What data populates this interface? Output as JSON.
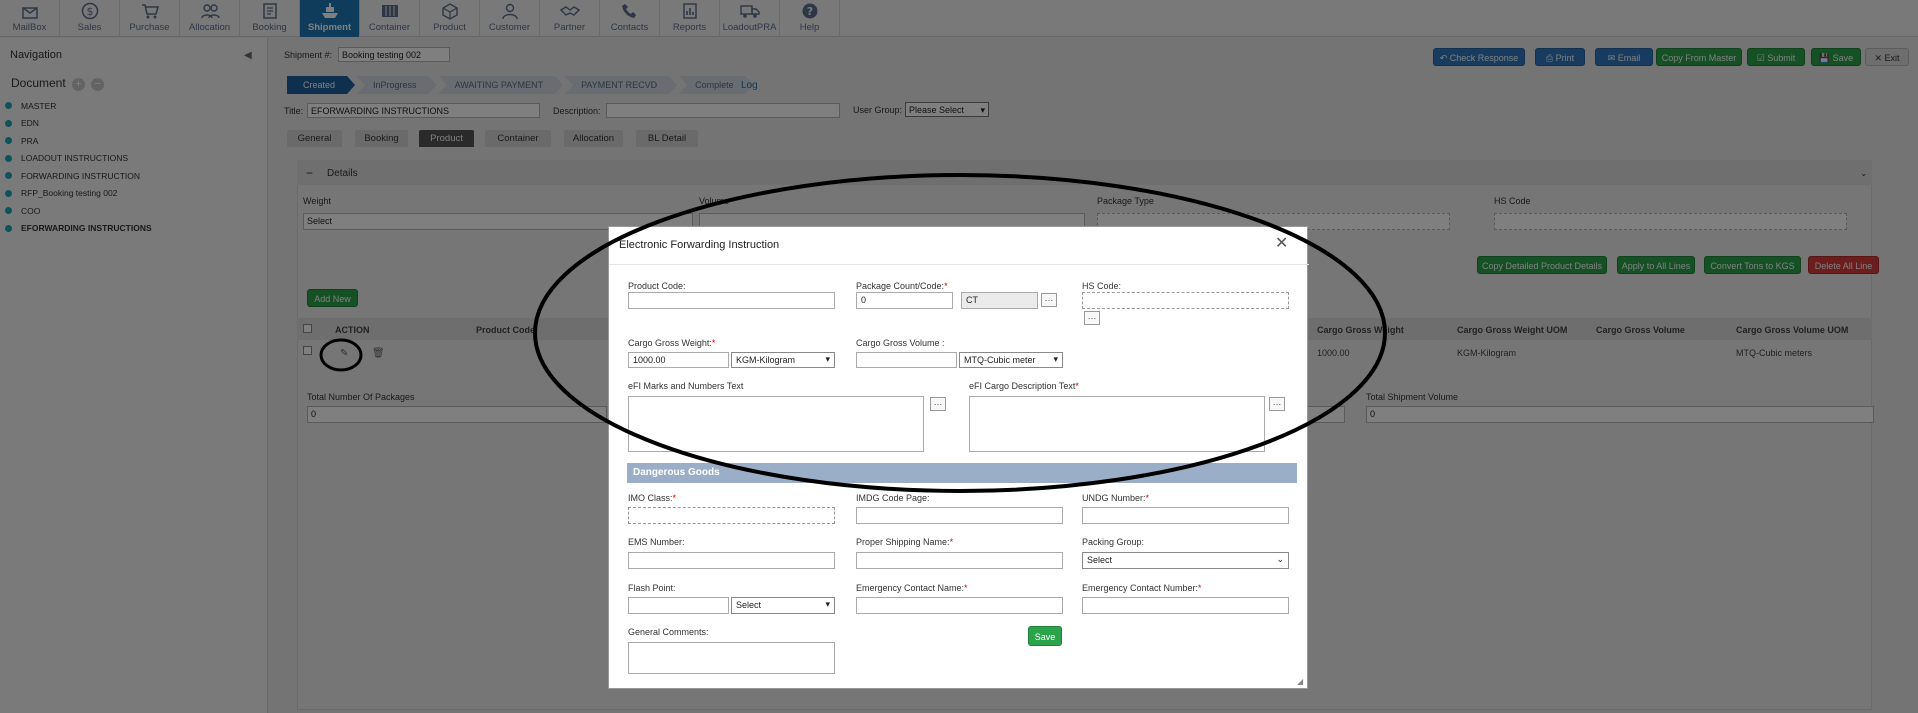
{
  "topnav": [
    {
      "label": "MailBox",
      "icon": "mailbox-icon"
    },
    {
      "label": "Sales",
      "icon": "dollar-icon"
    },
    {
      "label": "Purchase",
      "icon": "cart-icon"
    },
    {
      "label": "Allocation",
      "icon": "people-icon"
    },
    {
      "label": "Booking",
      "icon": "booking-icon"
    },
    {
      "label": "Shipment",
      "icon": "ship-icon",
      "active": true
    },
    {
      "label": "Container",
      "icon": "container-icon"
    },
    {
      "label": "Product",
      "icon": "product-icon"
    },
    {
      "label": "Customer",
      "icon": "customer-icon"
    },
    {
      "label": "Partner",
      "icon": "handshake-icon"
    },
    {
      "label": "Contacts",
      "icon": "phone-icon"
    },
    {
      "label": "Reports",
      "icon": "report-icon"
    },
    {
      "label": "LoadoutPRA",
      "icon": "truck-icon"
    },
    {
      "label": "Help",
      "icon": "help-icon"
    }
  ],
  "sidebar": {
    "title": "Navigation",
    "document_label": "Document",
    "items": [
      {
        "label": "MASTER"
      },
      {
        "label": "EDN"
      },
      {
        "label": "PRA"
      },
      {
        "label": "LOADOUT INSTRUCTIONS"
      },
      {
        "label": "FORWARDING INSTRUCTION"
      },
      {
        "label": "RFP_Booking testing 002"
      },
      {
        "label": "COO"
      },
      {
        "label": "EFORWARDING INSTRUCTIONS",
        "active": true
      }
    ]
  },
  "header": {
    "shipment_label": "Shipment #:",
    "shipment_value": "Booking testing 002",
    "title_label": "Title:",
    "title_value": "EFORWARDING INSTRUCTIONS",
    "description_label": "Description:",
    "user_group_label": "User Group:",
    "user_group_value": "Please Select",
    "buttons": {
      "check_response": "Check Response",
      "print": "Print",
      "email": "Email",
      "copy_from_master": "Copy From Master",
      "submit": "Submit",
      "save": "Save",
      "exit": "Exit"
    }
  },
  "steps": [
    "Created",
    "InProgress",
    "AWAITING PAYMENT",
    "PAYMENT RECVD",
    "Complete"
  ],
  "log_label": "Log",
  "tabs": [
    "General",
    "Booking",
    "Product",
    "Container",
    "Allocation",
    "BL Detail"
  ],
  "details": {
    "title": "Details",
    "weight_label": "Weight",
    "weight_value": "Select",
    "volume_label": "Volume",
    "package_type_label": "Package Type",
    "hs_code_label": "HS Code",
    "buttons": {
      "copy_detailed": "Copy Detailed Product Details",
      "apply_all": "Apply to All Lines",
      "convert": "Convert Tons to KGS",
      "delete_all": "Delete All Line"
    },
    "add_new": "Add New",
    "columns": [
      "ACTION",
      "Product Code",
      "Cargo Gross Weight",
      "Cargo Gross Weight UOM",
      "Cargo Gross Volume",
      "Cargo Gross Volume UOM"
    ],
    "row": {
      "weight": "1000.00",
      "weight_uom": "KGM-Kilogram",
      "volume_uom": "MTQ-Cubic meters"
    },
    "total_packages_label": "Total Number Of Packages",
    "total_packages_value": "0",
    "total_volume_label": "Total Shipment Volume",
    "total_volume_value": "0"
  },
  "modal": {
    "title": "Electronic Forwarding Instruction",
    "product_code_label": "Product Code:",
    "package_count_label": "Package Count/Code:",
    "package_count_value": "0",
    "package_code_value": "CT",
    "hs_code_label": "HS Code:",
    "gross_weight_label": "Cargo Gross Weight:",
    "gross_weight_value": "1000.00",
    "gross_weight_uom": "KGM-Kilogram",
    "gross_volume_label": "Cargo Gross Volume :",
    "gross_volume_uom": "MTQ-Cubic meter",
    "marks_label": "eFI Marks and Numbers Text",
    "cargo_desc_label": "eFI Cargo Description Text",
    "dangerous_goods": "Dangerous Goods",
    "imo_label": "IMO Class:",
    "imdg_label": "IMDG Code Page:",
    "undg_label": "UNDG Number:",
    "ems_label": "EMS Number:",
    "proper_name_label": "Proper Shipping Name:",
    "packing_group_label": "Packing Group:",
    "packing_group_value": "Select",
    "flash_point_label": "Flash Point:",
    "flash_unit_value": "Select",
    "emergency_name_label": "Emergency Contact Name:",
    "emergency_number_label": "Emergency Contact Number:",
    "comments_label": "General Comments:",
    "save": "Save"
  },
  "colors": {
    "accent": "#1f78b4",
    "green": "#2aa34a",
    "red": "#d93a3a",
    "dg_band": "#9aaec8"
  }
}
